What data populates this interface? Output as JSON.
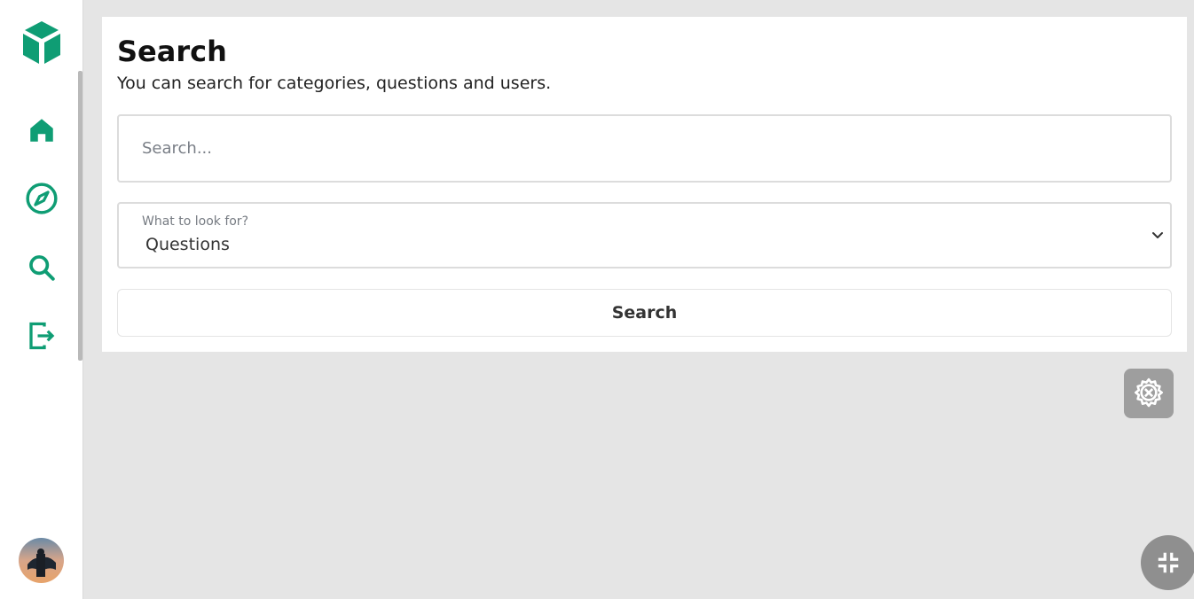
{
  "colors": {
    "accent": "#0f9d74",
    "background": "#e5e5e5",
    "card": "#ffffff",
    "floating_button": "#9e9e9e"
  },
  "sidebar": {
    "logo_icon": "cube-icon",
    "items": [
      {
        "icon": "home-icon"
      },
      {
        "icon": "compass-icon"
      },
      {
        "icon": "search-icon"
      },
      {
        "icon": "logout-icon"
      }
    ],
    "avatar_icon": "user-avatar"
  },
  "main": {
    "title": "Search",
    "subtitle": "You can search for categories, questions and users.",
    "search": {
      "placeholder": "Search...",
      "value": ""
    },
    "filter": {
      "label": "What to look for?",
      "selected": "Questions"
    },
    "submit_label": "Search"
  },
  "floating": {
    "tools_icon": "gear-tools-icon",
    "collapse_icon": "collapse-icon"
  }
}
